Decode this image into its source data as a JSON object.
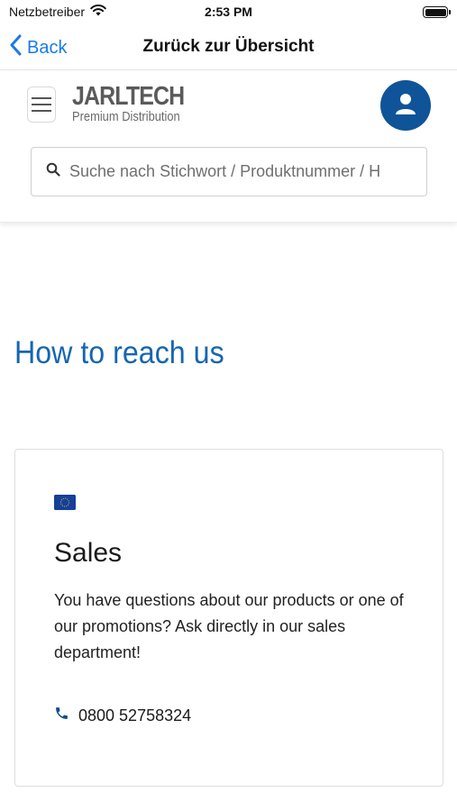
{
  "status_bar": {
    "carrier": "Netzbetreiber",
    "time": "2:53 PM",
    "icons": [
      "wifi-icon",
      "battery-icon"
    ]
  },
  "nav_bar": {
    "back_label": "Back",
    "title": "Zurück zur Übersicht"
  },
  "header": {
    "logo_main": "JARLTECH",
    "logo_sub": "Premium Distribution",
    "search_placeholder": "Suche nach Stichwort / Produktnummer / H",
    "accent_color": "#0f5499"
  },
  "main": {
    "heading": "How to reach us",
    "card": {
      "flag_icon": "eu-flag-icon",
      "title": "Sales",
      "text": "You have questions about our products or one of our promotions? Ask directly in our sales department!",
      "phone": "0800 52758324"
    }
  }
}
